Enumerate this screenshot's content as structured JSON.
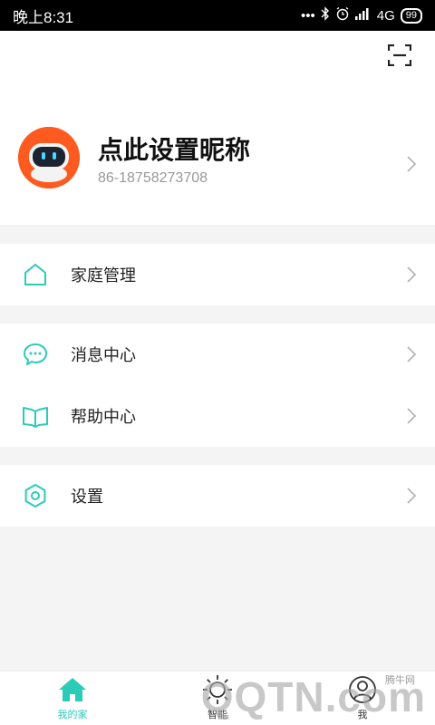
{
  "status_bar": {
    "time": "晚上8:31",
    "dots": "•••",
    "network": "4G",
    "battery": "99"
  },
  "profile": {
    "nickname": "点此设置昵称",
    "phone": "86-18758273708"
  },
  "menu": {
    "family_management": "家庭管理",
    "messages": "消息中心",
    "help": "帮助中心",
    "settings": "设置"
  },
  "tabs": [
    {
      "label": "我的家",
      "active": true
    },
    {
      "label": "智能",
      "active": false
    },
    {
      "label": "我",
      "active": false
    }
  ],
  "watermark": {
    "text": "QQTN.com",
    "sub": "腾牛网"
  },
  "colors": {
    "accent": "#2bcbb8",
    "avatar_bg": "#ff5a1f"
  }
}
